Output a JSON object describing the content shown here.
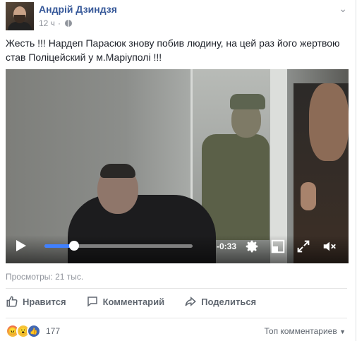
{
  "post": {
    "author": "Андрій Дзиндзя",
    "time": "12 ч",
    "text": "Жесть !!! Нардеп Парасюк знову побив людину, на цей раз його жертвою став Поліцейский у м.Маріуполі !!!"
  },
  "video": {
    "remaining": "-0:33",
    "progress": 0.2
  },
  "stats": {
    "views": "Просмотры: 21 тыс.",
    "reactions_count": "177"
  },
  "actions": {
    "like": "Нравится",
    "comment": "Комментарий",
    "share": "Поделиться"
  },
  "comments": {
    "sort_label": "Топ комментариев"
  },
  "colors": {
    "link": "#365899",
    "progress": "#4080ff",
    "muted": "#90949c"
  }
}
